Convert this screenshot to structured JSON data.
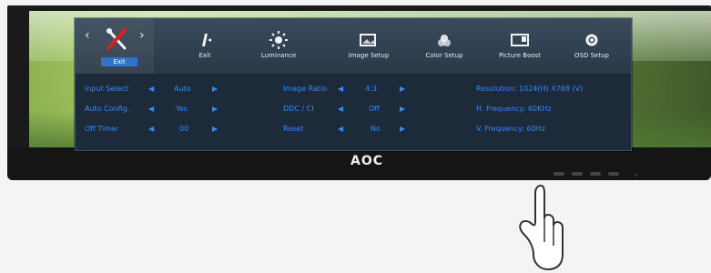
{
  "brand": {
    "logo_text": "AOC"
  },
  "osd": {
    "selected_label": "Exit",
    "tabs": [
      {
        "label": "Exit",
        "icon": "exit-icon"
      },
      {
        "label": "Luminance",
        "icon": "luminance-icon"
      },
      {
        "label": "Image Setup",
        "icon": "image-setup-icon"
      },
      {
        "label": "Color Setup",
        "icon": "color-setup-icon"
      },
      {
        "label": "Picture Boost",
        "icon": "picture-boost-icon"
      },
      {
        "label": "OSD Setup",
        "icon": "osd-setup-icon"
      }
    ],
    "left_settings": [
      {
        "label": "Input Select",
        "value": "Auto"
      },
      {
        "label": "Auto Config.",
        "value": "Yes"
      },
      {
        "label": "Off Timer",
        "value": "00"
      }
    ],
    "middle_settings": [
      {
        "label": "Image Ratio",
        "value": "4:3"
      },
      {
        "label": "DDC / CI",
        "value": "Off"
      },
      {
        "label": "Reset",
        "value": "No"
      }
    ],
    "info": {
      "resolution": "Resolution: 1024(H) X768 (V)",
      "h_frequency": "H. Frequency: 60KHz",
      "v_frequency": "V. Frequency: 60Hz"
    }
  }
}
